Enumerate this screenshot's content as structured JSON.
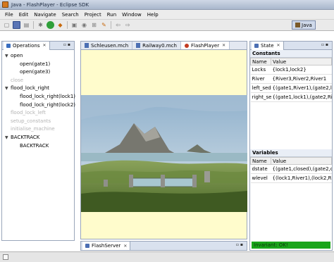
{
  "window": {
    "title": "Java - FlashPlayer - Eclipse SDK"
  },
  "menu": [
    "File",
    "Edit",
    "Navigate",
    "Search",
    "Project",
    "Run",
    "Window",
    "Help"
  ],
  "perspective": {
    "label": "Java"
  },
  "operations": {
    "tab_label": "Operations",
    "items": [
      {
        "label": "open",
        "level": 0,
        "expanded": true,
        "enabled": true
      },
      {
        "label": "open(gate1)",
        "level": 1,
        "enabled": true
      },
      {
        "label": "open(gate3)",
        "level": 1,
        "enabled": true
      },
      {
        "label": "close",
        "level": 0,
        "enabled": false
      },
      {
        "label": "flood_lock_right",
        "level": 0,
        "expanded": true,
        "enabled": true
      },
      {
        "label": "flood_lock_right(lock1)",
        "level": 1,
        "enabled": true
      },
      {
        "label": "flood_lock_right(lock2)",
        "level": 1,
        "enabled": true
      },
      {
        "label": "flood_lock_left",
        "level": 0,
        "enabled": false
      },
      {
        "label": "setup_constants",
        "level": 0,
        "enabled": false
      },
      {
        "label": "initialise_machine",
        "level": 0,
        "enabled": false
      },
      {
        "label": "BACKTRACK",
        "level": 0,
        "expanded": true,
        "enabled": true
      },
      {
        "label": "BACKTRACK",
        "level": 1,
        "enabled": true
      }
    ]
  },
  "editor": {
    "tabs": [
      {
        "label": "Schleusen.mch",
        "active": false
      },
      {
        "label": "Railway0.mch",
        "active": false
      },
      {
        "label": "FlashPlayer",
        "active": true
      }
    ],
    "background_color": "#fffccc"
  },
  "flash_server": {
    "tab_label": "FlashServer"
  },
  "state": {
    "tab_label": "State",
    "constants_title": "Constants",
    "variables_title": "Variables",
    "columns": [
      "Name",
      "Value"
    ],
    "constants": [
      {
        "name": "Locks",
        "value": "{lock1,lock2}"
      },
      {
        "name": "River",
        "value": "{River3,River2,River1"
      },
      {
        "name": "left_sed",
        "value": "{(gate1,River1),(gate2,lo"
      },
      {
        "name": "right_se",
        "value": "{(gate1,lock1),(gate2,Ri"
      }
    ],
    "variables": [
      {
        "name": "dstate",
        "value": "{(gate1,closed),(gate2,c"
      },
      {
        "name": "wlevel",
        "value": "{(lock1,River1),(lock2,Ri"
      }
    ],
    "invariant": {
      "text": "Invariant: OK!",
      "color": "#1aa51a"
    }
  }
}
